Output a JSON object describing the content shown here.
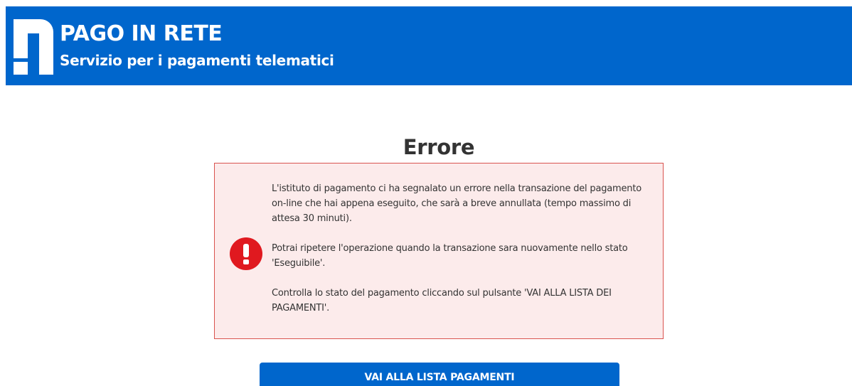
{
  "header": {
    "title": "PAGO IN RETE",
    "subtitle": "Servizio per i pagamenti telematici",
    "logo_icon": "pago-in-rete-logo",
    "background_color": "#0066cc"
  },
  "main": {
    "title": "Errore",
    "alert": {
      "icon": "exclamation-icon",
      "icon_color": "#e0191f",
      "background_color": "#fcebeb",
      "border_color": "#d9534f",
      "paragraphs": [
        "L'istituto di pagamento ci ha segnalato un errore nella transazione del pagamento on-line che hai appena eseguito, che sarà a breve annullata (tempo massimo di attesa 30 minuti).",
        "Potrai ripetere l'operazione quando la transazione sara nuovamente nello stato 'Eseguibile'.",
        "Controlla lo stato del pagamento cliccando sul pulsante 'VAI ALLA LISTA DEI PAGAMENTI'."
      ]
    },
    "button_label": "VAI ALLA LISTA PAGAMENTI"
  }
}
